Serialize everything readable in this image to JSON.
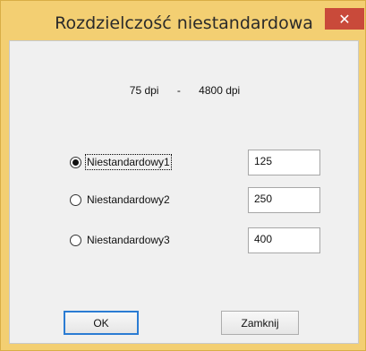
{
  "window": {
    "title": "Rozdzielczość niestandardowa",
    "close_symbol": "✕"
  },
  "range": {
    "min": "75 dpi",
    "separator": "-",
    "max": "4800 dpi"
  },
  "options": [
    {
      "label": "Niestandardowy1",
      "value": "125",
      "checked": true
    },
    {
      "label": "Niestandardowy2",
      "value": "250",
      "checked": false
    },
    {
      "label": "Niestandardowy3",
      "value": "400",
      "checked": false
    }
  ],
  "buttons": {
    "ok_label": "OK",
    "close_label": "Zamknij"
  },
  "colors": {
    "title_bar": "#f3cf72",
    "close_button": "#c94a3a",
    "dialog_bg": "#f0f0f0",
    "focus_border": "#2b7cd3"
  },
  "icons": {
    "close": "close-icon"
  }
}
